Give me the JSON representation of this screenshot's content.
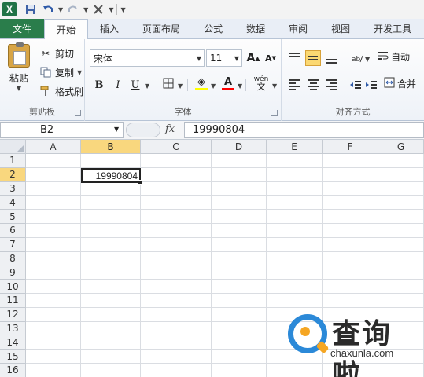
{
  "quick_access": {
    "icons": [
      "excel-logo",
      "save-icon",
      "undo-icon",
      "redo-icon",
      "format-painter-icon",
      "customize-icon"
    ]
  },
  "ribbon_tabs": {
    "file": "文件",
    "home": "开始",
    "insert": "插入",
    "page_layout": "页面布局",
    "formulas": "公式",
    "data": "数据",
    "review": "审阅",
    "view": "视图",
    "developer": "开发工具"
  },
  "clipboard": {
    "paste": "粘贴",
    "cut": "剪切",
    "copy": "复制",
    "format_painter": "格式刷",
    "group_label": "剪贴板"
  },
  "font": {
    "font_name": "宋体",
    "font_size": "11",
    "bold": "B",
    "italic": "I",
    "underline": "U",
    "grow": "A",
    "shrink": "A",
    "wen": "wén",
    "group_label": "字体",
    "fill_color": "#ffff00",
    "font_color": "#ff0000"
  },
  "alignment": {
    "wrap_text": "自动",
    "merge": "合并",
    "group_label": "对齐方式"
  },
  "formula_bar": {
    "name_box": "B2",
    "fx": "fx",
    "value": "19990804"
  },
  "grid": {
    "columns": [
      "A",
      "B",
      "C",
      "D",
      "E",
      "F",
      "G"
    ],
    "rows": [
      "1",
      "2",
      "3",
      "4",
      "5",
      "6",
      "7",
      "8",
      "9",
      "10",
      "11",
      "12",
      "13",
      "14",
      "15",
      "16"
    ],
    "selected_column": "B",
    "selected_row": "2",
    "active_cell_value": "19990804"
  },
  "watermark": {
    "name": "查询啦",
    "url": "chaxunla.com"
  }
}
